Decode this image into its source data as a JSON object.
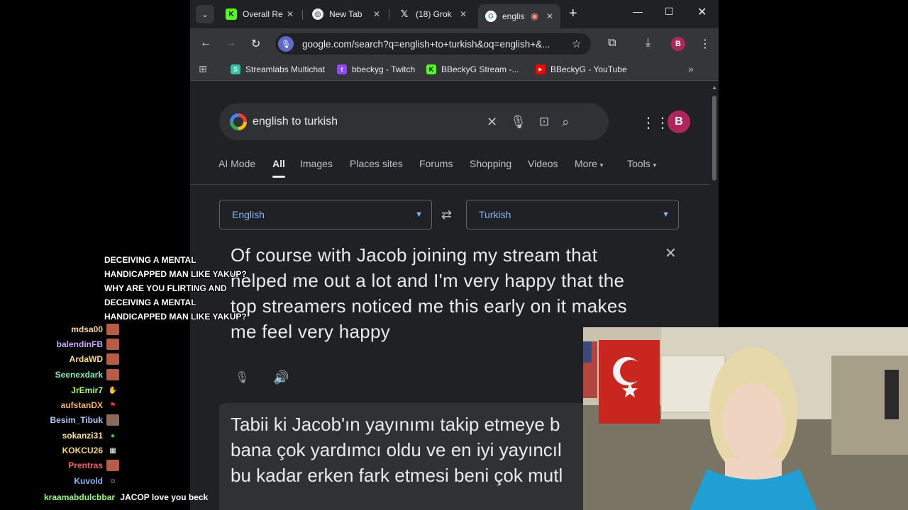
{
  "browser": {
    "tabs": [
      {
        "label": "Overall Re",
        "favicon": "kick-icon",
        "active": false
      },
      {
        "label": "New Tab",
        "favicon": "chrome-icon",
        "active": false
      },
      {
        "label": "(18) Grok",
        "favicon": "x-icon",
        "active": false
      },
      {
        "label": "englis",
        "favicon": "google-icon",
        "active": true,
        "recording": true
      }
    ],
    "address_url": "google.com/search?q=english+to+turkish&oq=english+&...",
    "profile_initial": "B",
    "bookmarks": [
      {
        "label": "Streamlabs Multichat",
        "icon": "streamlabs-icon"
      },
      {
        "label": "bbeckyg - Twitch",
        "icon": "twitch-icon"
      },
      {
        "label": "BBeckyG Stream -...",
        "icon": "kick-icon"
      },
      {
        "label": "BBeckyG - YouTube",
        "icon": "youtube-icon"
      }
    ]
  },
  "search": {
    "query": "english to turkish",
    "avatar_initial": "B",
    "filters": [
      "AI Mode",
      "All",
      "Images",
      "Places sites",
      "Forums",
      "Shopping",
      "Videos",
      "More",
      "Tools"
    ],
    "active_filter": "All"
  },
  "translate": {
    "source_lang": "English",
    "target_lang": "Turkish",
    "source_text": "Of course with Jacob joining my stream that helped me out a lot and I'm very happy that the top streamers noticed me this early on it makes me feel very happy",
    "target_text": "Tabii ki Jacob'ın yayınımı takip etmeye b\nbana çok yardımcı oldu ve en iyi yayıncıl\nbu kadar erken fark etmesi beni çok mutl"
  },
  "overlay": {
    "alert_text": "DECEIVING A MENTAL HANDICAPPED MAN LIKE YAKUP? WHY ARE YOU FLIRTING AND DECEIVING A MENTAL HANDICAPPED MAN LIKE YAKUP?",
    "chat": [
      {
        "name": "mdsa00",
        "color": "#ffd27a"
      },
      {
        "name": "balendinFB",
        "color": "#c9a5ff"
      },
      {
        "name": "ArdaWD",
        "color": "#ffe066"
      },
      {
        "name": "Seenexdark",
        "color": "#7cf2c2"
      },
      {
        "name": "JrEmir7",
        "color": "#a8ff60"
      },
      {
        "name": "aufstanDX",
        "color": "#ffb347"
      },
      {
        "name": "Besim_Tibuk",
        "color": "#a9c8ff"
      },
      {
        "name": "sokanzi31",
        "color": "#ffe08a"
      },
      {
        "name": "KOKCU26",
        "color": "#ffd95a"
      },
      {
        "name": "Prentras",
        "color": "#ff5a5a"
      },
      {
        "name": "Kuvold",
        "color": "#8ab4ff"
      }
    ],
    "last_message": {
      "name": "kraamabdulcbbar",
      "color": "#8fff6f",
      "text": "JACOP love you beck"
    }
  }
}
